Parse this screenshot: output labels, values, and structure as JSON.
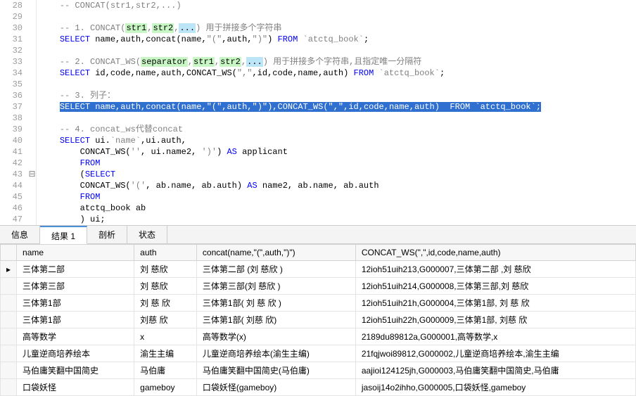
{
  "lines": [
    {
      "n": 28,
      "f": "",
      "seg": [
        {
          "c": "cmt",
          "t": "-- CONCAT(str1,str2,...)"
        }
      ]
    },
    {
      "n": 29,
      "f": "",
      "seg": []
    },
    {
      "n": 30,
      "f": "",
      "seg": [
        {
          "c": "cmt",
          "t": "-- 1. CONCAT("
        },
        {
          "c": "param",
          "t": "str1"
        },
        {
          "c": "cmt",
          "t": ","
        },
        {
          "c": "param",
          "t": "str2"
        },
        {
          "c": "cmt",
          "t": ","
        },
        {
          "c": "param2",
          "t": "..."
        },
        {
          "c": "cmt",
          "t": ") 用于拼接多个字符串"
        }
      ]
    },
    {
      "n": 31,
      "f": "",
      "seg": [
        {
          "c": "kw",
          "t": "SELECT"
        },
        {
          "c": "",
          "t": " name,auth,concat(name,"
        },
        {
          "c": "str",
          "t": "\"(\""
        },
        {
          "c": "",
          "t": ",auth,"
        },
        {
          "c": "str",
          "t": "\")\""
        },
        {
          "c": "",
          "t": ") "
        },
        {
          "c": "kw",
          "t": "FROM"
        },
        {
          "c": "",
          "t": " "
        },
        {
          "c": "str",
          "t": "`atctq_book`"
        },
        {
          "c": "",
          "t": ";"
        }
      ]
    },
    {
      "n": 32,
      "f": "",
      "seg": []
    },
    {
      "n": 33,
      "f": "",
      "seg": [
        {
          "c": "cmt",
          "t": "-- 2. CONCAT_WS("
        },
        {
          "c": "param",
          "t": "separator"
        },
        {
          "c": "cmt",
          "t": ","
        },
        {
          "c": "param",
          "t": "str1"
        },
        {
          "c": "cmt",
          "t": ","
        },
        {
          "c": "param",
          "t": "str2"
        },
        {
          "c": "cmt",
          "t": ","
        },
        {
          "c": "param2",
          "t": "..."
        },
        {
          "c": "cmt",
          "t": ") 用于拼接多个字符串,且指定唯一分隔符"
        }
      ]
    },
    {
      "n": 34,
      "f": "",
      "seg": [
        {
          "c": "kw",
          "t": "SELECT"
        },
        {
          "c": "",
          "t": " id,code,name,auth,CONCAT_WS("
        },
        {
          "c": "str",
          "t": "\",\""
        },
        {
          "c": "",
          "t": ",id,code,name,auth) "
        },
        {
          "c": "kw",
          "t": "FROM"
        },
        {
          "c": "",
          "t": " "
        },
        {
          "c": "str",
          "t": "`atctq_book`"
        },
        {
          "c": "",
          "t": ";"
        }
      ]
    },
    {
      "n": 35,
      "f": "",
      "seg": []
    },
    {
      "n": 36,
      "f": "",
      "seg": [
        {
          "c": "cmt",
          "t": "-- 3. 列子："
        }
      ]
    },
    {
      "n": 37,
      "f": "",
      "sel": true,
      "seg": [
        {
          "c": "kw",
          "t": "SELECT"
        },
        {
          "c": "",
          "t": " name,auth,concat(name,"
        },
        {
          "c": "str",
          "t": "\"(\""
        },
        {
          "c": "",
          "t": ",auth,"
        },
        {
          "c": "str",
          "t": "\")\""
        },
        {
          "c": "",
          "t": "),CONCAT_WS("
        },
        {
          "c": "str",
          "t": "\",\""
        },
        {
          "c": "",
          "t": ",id,code,name,auth)  "
        },
        {
          "c": "kw",
          "t": "FROM"
        },
        {
          "c": "",
          "t": " "
        },
        {
          "c": "str",
          "t": "`atctq_book`"
        },
        {
          "c": "",
          "t": ";"
        }
      ]
    },
    {
      "n": 38,
      "f": "",
      "seg": []
    },
    {
      "n": 39,
      "f": "",
      "seg": [
        {
          "c": "cmt",
          "t": "-- 4. concat_ws代替concat"
        }
      ]
    },
    {
      "n": 40,
      "f": "",
      "seg": [
        {
          "c": "kw",
          "t": "SELECT"
        },
        {
          "c": "",
          "t": " ui."
        },
        {
          "c": "str",
          "t": "`name`"
        },
        {
          "c": "",
          "t": ",ui.auth,"
        }
      ]
    },
    {
      "n": 41,
      "f": "",
      "seg": [
        {
          "c": "",
          "t": "    CONCAT_WS("
        },
        {
          "c": "str",
          "t": "''"
        },
        {
          "c": "",
          "t": ", ui.name2, "
        },
        {
          "c": "str",
          "t": "')'"
        },
        {
          "c": "",
          "t": ") "
        },
        {
          "c": "kw",
          "t": "AS"
        },
        {
          "c": "",
          "t": " applicant"
        }
      ]
    },
    {
      "n": 42,
      "f": "",
      "seg": [
        {
          "c": "",
          "t": "    "
        },
        {
          "c": "kw",
          "t": "FROM"
        }
      ]
    },
    {
      "n": 43,
      "f": "⊟",
      "seg": [
        {
          "c": "",
          "t": "    ("
        },
        {
          "c": "kw",
          "t": "SELECT"
        }
      ]
    },
    {
      "n": 44,
      "f": "",
      "seg": [
        {
          "c": "",
          "t": "    CONCAT_WS("
        },
        {
          "c": "str",
          "t": "'('"
        },
        {
          "c": "",
          "t": ", ab.name, ab.auth) "
        },
        {
          "c": "kw",
          "t": "AS"
        },
        {
          "c": "",
          "t": " name2, ab.name, ab.auth"
        }
      ]
    },
    {
      "n": 45,
      "f": "",
      "seg": [
        {
          "c": "",
          "t": "    "
        },
        {
          "c": "kw",
          "t": "FROM"
        }
      ]
    },
    {
      "n": 46,
      "f": "",
      "seg": [
        {
          "c": "",
          "t": "    atctq_book ab"
        }
      ]
    },
    {
      "n": 47,
      "f": "",
      "seg": [
        {
          "c": "",
          "t": "    ) ui;"
        }
      ]
    }
  ],
  "tabs": [
    "信息",
    "结果 1",
    "剖析",
    "状态"
  ],
  "active_tab": 1,
  "columns": [
    "name",
    "auth",
    "concat(name,\"(\",auth,\")\")",
    "CONCAT_WS(\",\",id,code,name,auth)"
  ],
  "rows": [
    [
      "三体第二部",
      "刘 慈欣",
      "三体第二部 (刘 慈欣  )",
      "12ioh51uih213,G000007,三体第二部 ,刘 慈欣"
    ],
    [
      "三体第三部",
      "刘 慈欣",
      "三体第三部(刘 慈欣 )",
      "12ioh51uih214,G000008,三体第三部,刘 慈欣"
    ],
    [
      "三体第1部",
      " 刘 慈 欣",
      "三体第1部(  刘 慈 欣 )",
      "12ioh51uih21h,G000004,三体第1部,  刘 慈 欣"
    ],
    [
      "三体第1部",
      "刘慈 欣",
      "三体第1部( 刘慈 欣)",
      "12ioh51uih22h,G000009,三体第1部, 刘慈 欣"
    ],
    [
      "高等数学",
      "x",
      "高等数学(x)",
      "2189du89812a,G000001,高等数学,x"
    ],
    [
      "儿童逆商培养绘本",
      "渝生主编",
      "儿童逆商培养绘本(渝生主编)",
      "21fqjwoi89812,G000002,儿童逆商培养绘本,渝生主编"
    ],
    [
      "马伯庸笑翻中国简史",
      "马伯庸",
      "马伯庸笑翻中国简史(马伯庸)",
      "aajioi124125jh,G000003,马伯庸笑翻中国简史,马伯庸"
    ],
    [
      "口袋妖怪",
      "gameboy",
      "口袋妖怪(gameboy)",
      "jasoij14o2ihho,G000005,口袋妖怪,gameboy"
    ]
  ],
  "current_row": 0
}
